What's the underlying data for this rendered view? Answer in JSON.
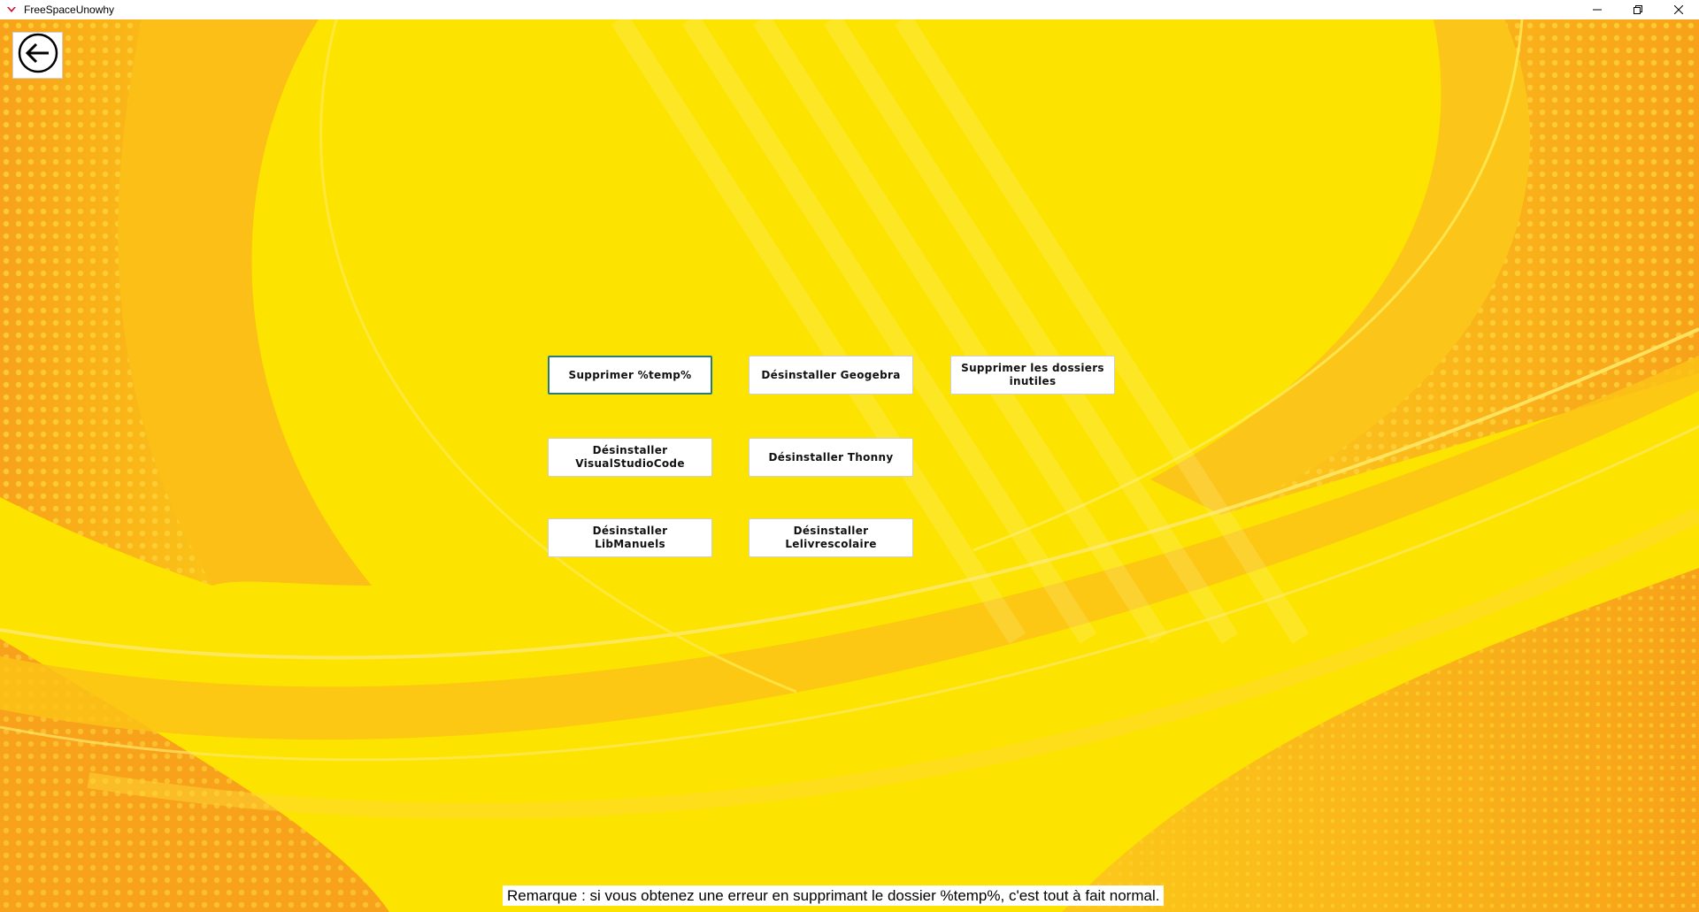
{
  "window": {
    "title": "FreeSpaceUnowhy",
    "controls": [
      "minimize-icon",
      "restore-icon",
      "close-icon"
    ]
  },
  "back_button": {
    "icon": "back-arrow-icon"
  },
  "buttons": {
    "temp": "Supprimer %temp%",
    "geogebra": "Désinstaller Geogebra",
    "dossiers": "Supprimer les dossiers inutiles",
    "vscode": "Désinstaller VisualStudioCode",
    "thonny": "Désinstaller Thonny",
    "libmanuels": "Désinstaller LibManuels",
    "lelivrescolaire": "Désinstaller Lelivrescolaire"
  },
  "note": "Remarque : si vous obtenez une erreur en supprimant le dossier %temp%, c'est tout à fait normal.",
  "colors": {
    "background_yellow": "#fde300",
    "accent_orange": "#f9a81a",
    "focus_border": "#2a7a7a"
  }
}
